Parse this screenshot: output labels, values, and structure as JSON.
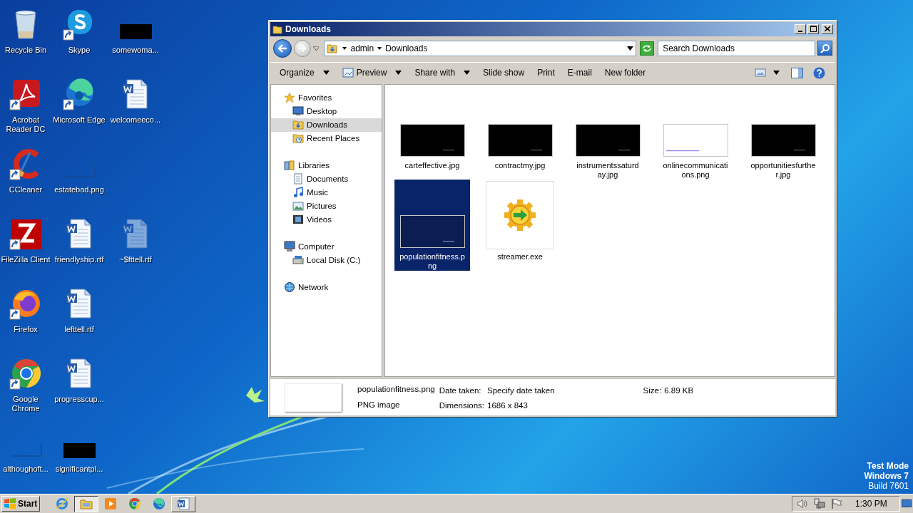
{
  "desktop": {
    "rows": [
      {
        "items": [
          {
            "label": "Recycle Bin",
            "kind": "recycle",
            "shortcut": false
          },
          {
            "label": "Skype",
            "kind": "skype",
            "shortcut": true
          },
          {
            "label": "somewoma...",
            "kind": "black",
            "shortcut": false
          }
        ]
      },
      {
        "items": [
          {
            "label": "Acrobat Reader DC",
            "kind": "acrobat",
            "shortcut": true
          },
          {
            "label": "Microsoft Edge",
            "kind": "edge",
            "shortcut": true
          },
          {
            "label": "welcomeeco...",
            "kind": "word",
            "shortcut": false
          }
        ]
      },
      {
        "items": [
          {
            "label": "CCleaner",
            "kind": "ccleaner",
            "shortcut": true
          },
          {
            "label": "estatebad.png",
            "kind": "blank",
            "shortcut": false
          }
        ]
      },
      {
        "items": [
          {
            "label": "FileZilla Client",
            "kind": "filezilla",
            "shortcut": true
          },
          {
            "label": "friendlyship.rtf",
            "kind": "word",
            "shortcut": false
          },
          {
            "label": "~$fttell.rtf",
            "kind": "word-hidden",
            "shortcut": false
          }
        ]
      },
      {
        "items": [
          {
            "label": "Firefox",
            "kind": "firefox",
            "shortcut": true
          },
          {
            "label": "lefttell.rtf",
            "kind": "word",
            "shortcut": false
          }
        ]
      },
      {
        "items": [
          {
            "label": "Google Chrome",
            "kind": "chrome",
            "shortcut": true
          },
          {
            "label": "progresscup...",
            "kind": "word",
            "shortcut": false
          }
        ]
      },
      {
        "items": [
          {
            "label": "althoughoft...",
            "kind": "blank",
            "shortcut": false
          },
          {
            "label": "significantpl...",
            "kind": "black",
            "shortcut": false
          }
        ]
      }
    ]
  },
  "window": {
    "title": "Downloads",
    "address": {
      "crumbs": [
        "admin",
        "Downloads"
      ]
    },
    "search": {
      "placeholder": "Search Downloads"
    },
    "toolbar": [
      {
        "label": "Organize",
        "dropdown": true,
        "icon": false
      },
      {
        "label": "Preview",
        "dropdown": true,
        "icon": true
      },
      {
        "label": "Share with",
        "dropdown": true,
        "icon": false
      },
      {
        "label": "Slide show",
        "dropdown": false,
        "icon": false
      },
      {
        "label": "Print",
        "dropdown": false,
        "icon": false
      },
      {
        "label": "E-mail",
        "dropdown": false,
        "icon": false
      },
      {
        "label": "New folder",
        "dropdown": false,
        "icon": false
      }
    ],
    "nav": [
      {
        "label": "Favorites",
        "kind": "star",
        "selected": false,
        "children": [
          {
            "label": "Desktop",
            "kind": "desktop",
            "selected": false
          },
          {
            "label": "Downloads",
            "kind": "downloads",
            "selected": true
          },
          {
            "label": "Recent Places",
            "kind": "recent",
            "selected": false
          }
        ]
      },
      {
        "label": "Libraries",
        "kind": "library",
        "selected": false,
        "children": [
          {
            "label": "Documents",
            "kind": "documents",
            "selected": false
          },
          {
            "label": "Music",
            "kind": "music",
            "selected": false
          },
          {
            "label": "Pictures",
            "kind": "pictures",
            "selected": false
          },
          {
            "label": "Videos",
            "kind": "videos",
            "selected": false
          }
        ]
      },
      {
        "label": "Computer",
        "kind": "computer",
        "selected": false,
        "children": [
          {
            "label": "Local Disk (C:)",
            "kind": "disk",
            "selected": false
          }
        ]
      },
      {
        "label": "Network",
        "kind": "network",
        "selected": false
      }
    ],
    "files": [
      {
        "name": "carteffective.jpg",
        "kind": "dark-image",
        "selected": false
      },
      {
        "name": "contractmy.jpg",
        "kind": "dark-image",
        "selected": false
      },
      {
        "name": "instrumentssaturday.jpg",
        "kind": "dark-image",
        "selected": false
      },
      {
        "name": "onlinecommunications.png",
        "kind": "light-image",
        "selected": false
      },
      {
        "name": "opportunitiesfurther.jpg",
        "kind": "dark-image",
        "selected": false
      },
      {
        "name": "populationfitness.png",
        "kind": "dark-image",
        "selected": true
      },
      {
        "name": "streamer.exe",
        "kind": "program",
        "selected": false
      }
    ],
    "details": {
      "name": "populationfitness.png",
      "type": "PNG image",
      "columns": [
        [
          {
            "label": "Date taken:",
            "value": "Specify date taken"
          },
          {
            "label": "Dimensions:",
            "value": "1686 x 843"
          }
        ],
        [
          {
            "label": "Size:",
            "value": "6.89 KB"
          }
        ]
      ]
    }
  },
  "os_notice": [
    "Test Mode",
    "Windows 7",
    "Build 7601"
  ],
  "taskbar": {
    "start": "Start",
    "items": [
      {
        "kind": "ie",
        "running": false,
        "active": false
      },
      {
        "kind": "explorer",
        "running": true,
        "active": true
      },
      {
        "kind": "media",
        "running": false,
        "active": false
      },
      {
        "kind": "chrome",
        "running": false,
        "active": false
      },
      {
        "kind": "edge",
        "running": false,
        "active": false
      },
      {
        "kind": "word",
        "running": true,
        "active": false
      }
    ],
    "clock": "1:30 PM"
  }
}
